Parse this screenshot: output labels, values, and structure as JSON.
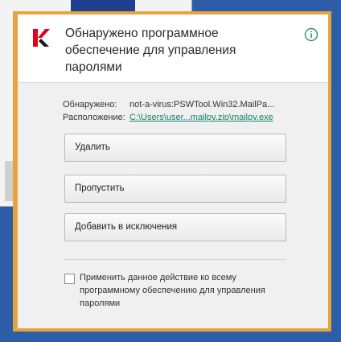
{
  "dialog": {
    "title": "Обнаружено программное обеспечение для управления паролями",
    "detected_label": "Обнаружено:",
    "detected_value": "not-a-virus:PSWTool.Win32.MailPa...",
    "location_label": "Расположение:",
    "location_value": "C:\\Users\\user...mailpv.zip\\mailpv.exe",
    "buttons": {
      "delete": "Удалить",
      "skip": "Пропустить",
      "exclude": "Добавить в исключения"
    },
    "apply_all_label": "Применить данное действие ко всему программному обеспечению для управления паролями",
    "apply_all_checked": false
  },
  "icons": {
    "logo": "kaspersky-logo",
    "info": "info-icon"
  },
  "colors": {
    "accent_green": "#14826d",
    "frame_orange": "#e7a43a",
    "logo_red": "#e4001b"
  }
}
